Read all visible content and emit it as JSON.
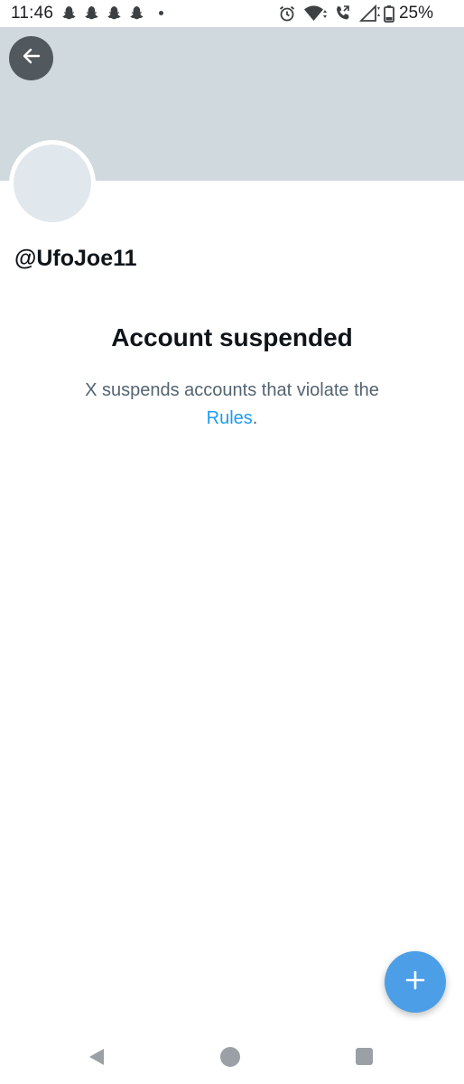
{
  "status_bar": {
    "time": "11:46",
    "battery": "25%",
    "left_icons": [
      "snapchat-icon",
      "snapchat-icon",
      "snapchat-icon",
      "snapchat-icon",
      "dot-icon"
    ],
    "right_icons": [
      "alarm-icon",
      "wifi-icon",
      "call-icon",
      "signal-icon",
      "battery-icon"
    ]
  },
  "profile": {
    "username": "@UfoJoe11",
    "banner_color": "#cfd9de",
    "avatar_color": "#e1e8ed"
  },
  "suspension": {
    "title": "Account suspended",
    "message": "X suspends accounts that violate the",
    "link_text": "Rules",
    "suffix": "."
  },
  "colors": {
    "link": "#1d9bf0",
    "fab": "#4c9fe6"
  },
  "fab": {
    "icon": "plus-icon"
  },
  "nav_bar": {
    "icons": [
      "nav-back-icon",
      "nav-home-icon",
      "nav-recents-icon"
    ]
  }
}
